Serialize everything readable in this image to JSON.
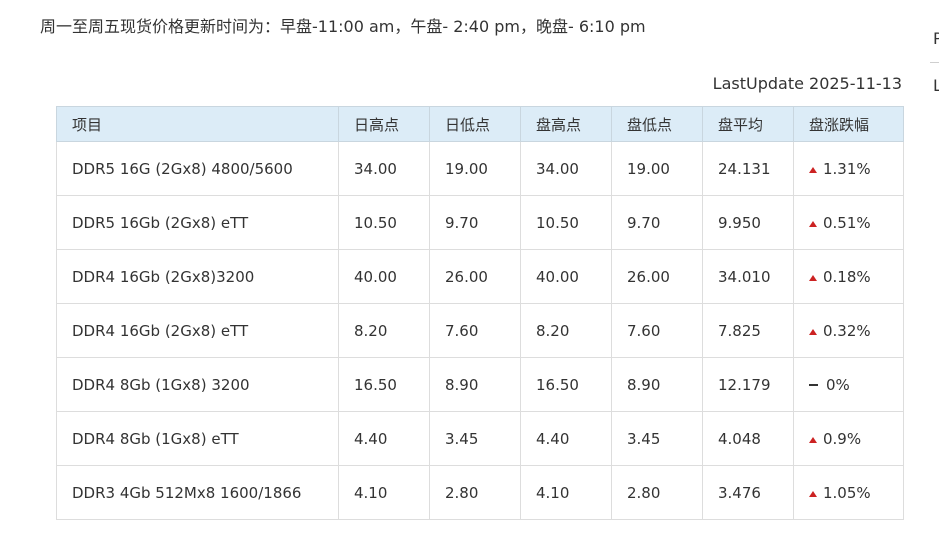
{
  "notice": "周一至周五现货价格更新时间为：早盘-11:00 am，午盘- 2:40 pm，晚盘- 6:10 pm",
  "side_letters": [
    "P",
    "L"
  ],
  "last_update": "LastUpdate 2025-11-13",
  "table": {
    "headers": [
      "项目",
      "日高点",
      "日低点",
      "盘高点",
      "盘低点",
      "盘平均",
      "盘涨跌幅"
    ],
    "rows": [
      {
        "item": "DDR5 16G (2Gx8) 4800/5600",
        "day_high": "34.00",
        "day_low": "19.00",
        "session_high": "34.00",
        "session_low": "19.00",
        "session_avg": "24.131",
        "change": "1.31%",
        "direction": "up"
      },
      {
        "item": "DDR5 16Gb (2Gx8) eTT",
        "day_high": "10.50",
        "day_low": "9.70",
        "session_high": "10.50",
        "session_low": "9.70",
        "session_avg": "9.950",
        "change": "0.51%",
        "direction": "up"
      },
      {
        "item": "DDR4 16Gb (2Gx8)3200",
        "day_high": "40.00",
        "day_low": "26.00",
        "session_high": "40.00",
        "session_low": "26.00",
        "session_avg": "34.010",
        "change": "0.18%",
        "direction": "up"
      },
      {
        "item": "DDR4 16Gb (2Gx8) eTT",
        "day_high": "8.20",
        "day_low": "7.60",
        "session_high": "8.20",
        "session_low": "7.60",
        "session_avg": "7.825",
        "change": "0.32%",
        "direction": "up"
      },
      {
        "item": "DDR4 8Gb (1Gx8) 3200",
        "day_high": "16.50",
        "day_low": "8.90",
        "session_high": "16.50",
        "session_low": "8.90",
        "session_avg": "12.179",
        "change": "0%",
        "direction": "flat"
      },
      {
        "item": "DDR4 8Gb (1Gx8) eTT",
        "day_high": "4.40",
        "day_low": "3.45",
        "session_high": "4.40",
        "session_low": "3.45",
        "session_avg": "4.048",
        "change": "0.9%",
        "direction": "up"
      },
      {
        "item": "DDR3 4Gb 512Mx8 1600/1866",
        "day_high": "4.10",
        "day_low": "2.80",
        "session_high": "4.10",
        "session_low": "2.80",
        "session_avg": "3.476",
        "change": "1.05%",
        "direction": "up"
      }
    ]
  },
  "colors": {
    "header_bg": "#dcecf7",
    "up_arrow": "#cc2222",
    "text": "#333333"
  },
  "icons": {
    "up": "triangle-up-icon",
    "flat": "dash-icon"
  }
}
